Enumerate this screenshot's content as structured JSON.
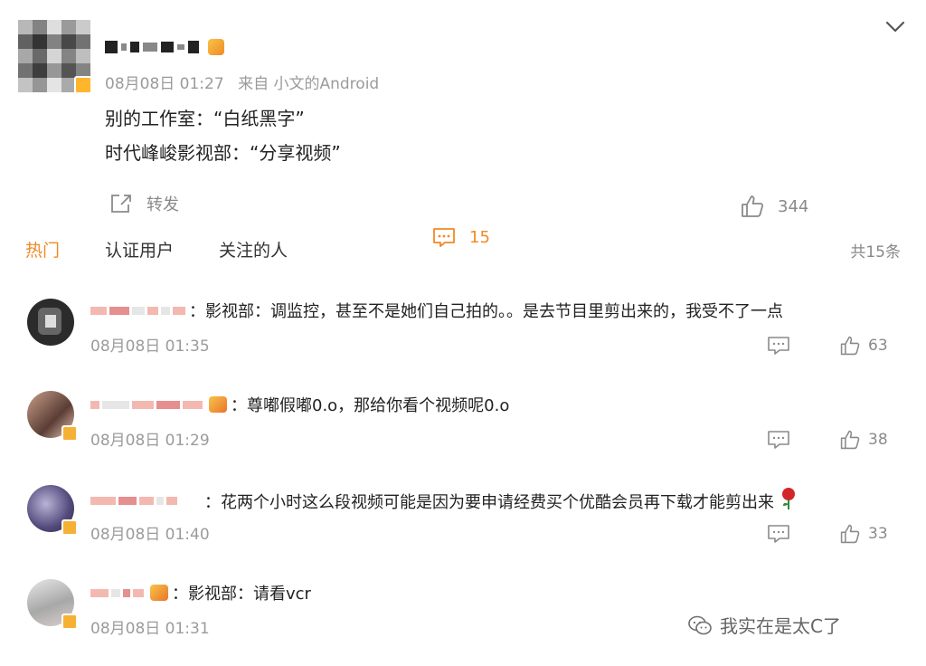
{
  "post": {
    "meta_time": "08月08日 01:27",
    "meta_source": "来自 小文的Android",
    "lines": [
      "别的工作室：“白纸黑字”",
      "时代峰峻影视部：“分享视频”"
    ],
    "repost_label": "转发",
    "comment_count": "15",
    "like_count": "344"
  },
  "tabs": [
    "热门",
    "认证用户",
    "关注的人"
  ],
  "total_count": "共15条",
  "comments": [
    {
      "text": "：影视部：调监控，甚至不是她们自己拍的。。是去节目里剪出来的，我受不了一点",
      "time": "08月08日 01:35",
      "likes": "63"
    },
    {
      "text": "：尊嘟假嘟0.o，那给你看个视频呢0.o",
      "time": "08月08日 01:29",
      "likes": "38"
    },
    {
      "text": "：花两个小时这么段视频可能是因为要申请经费买个优酷会员再下载才能剪出来",
      "time": "08月08日 01:40",
      "likes": "33"
    },
    {
      "text": "：影视部：请看vcr",
      "time": "08月08日 01:31",
      "likes": ""
    }
  ],
  "watermark": "我实在是太C了",
  "colors": {
    "accent": "#f08a24",
    "text": "#222222",
    "meta": "#9b9b9b"
  }
}
